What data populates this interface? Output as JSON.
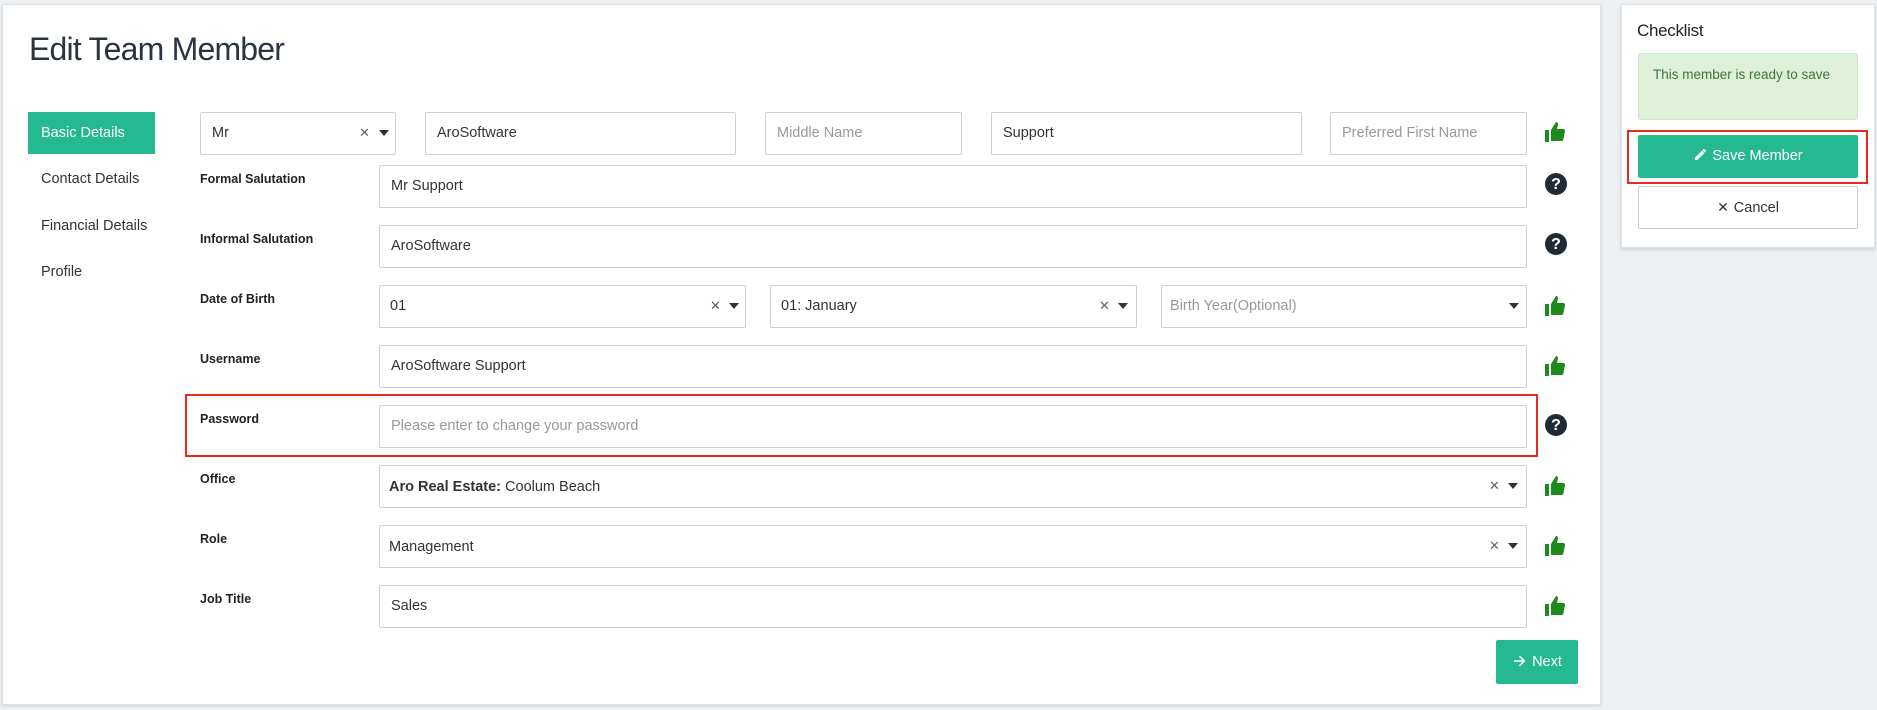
{
  "page": {
    "title": "Edit Team Member"
  },
  "nav": {
    "items": [
      {
        "label": "Basic Details",
        "active": true
      },
      {
        "label": "Contact Details"
      },
      {
        "label": "Financial Details"
      },
      {
        "label": "Profile"
      }
    ]
  },
  "name_row": {
    "title_value": "Mr",
    "first_name_value": "AroSoftware",
    "middle_name_placeholder": "Middle Name",
    "last_name_value": "Support",
    "preferred_first_name_placeholder": "Preferred First Name"
  },
  "fields": {
    "formal_salutation": {
      "label": "Formal Salutation",
      "value": "Mr Support"
    },
    "informal_salutation": {
      "label": "Informal Salutation",
      "value": "AroSoftware"
    },
    "date_of_birth": {
      "label": "Date of Birth",
      "day": "01",
      "month": "01: January",
      "year_placeholder": "Birth Year(Optional)"
    },
    "username": {
      "label": "Username",
      "value": "AroSoftware Support"
    },
    "password": {
      "label": "Password",
      "placeholder": "Please enter to change your password"
    },
    "office": {
      "label": "Office",
      "value_bold": "Aro Real Estate:",
      "value": " Coolum Beach"
    },
    "role": {
      "label": "Role",
      "value": "Management"
    },
    "job_title": {
      "label": "Job Title",
      "value": "Sales"
    }
  },
  "actions": {
    "next_label": "Next"
  },
  "checklist": {
    "title": "Checklist",
    "message": "This member is ready to save",
    "save_label": "Save Member",
    "cancel_label": "Cancel"
  },
  "icons": {
    "ok": "thumbs-up-icon",
    "help": "question-circle-icon"
  },
  "colors": {
    "accent": "#25b991",
    "ok_icon": "#1e8a1e",
    "highlight": "#e8291c",
    "success_bg": "#dff0d8",
    "success_text": "#3c763d"
  }
}
